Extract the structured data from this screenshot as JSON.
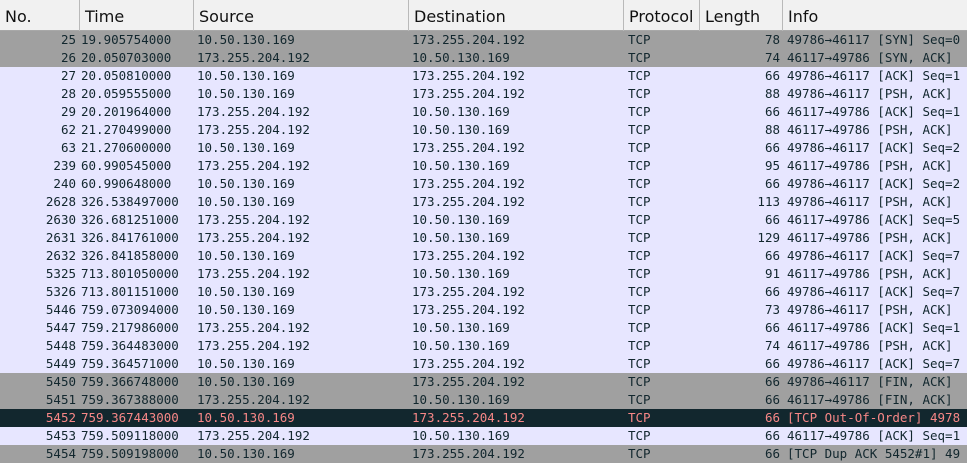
{
  "columns": [
    {
      "key": "no",
      "label": "No."
    },
    {
      "key": "time",
      "label": "Time"
    },
    {
      "key": "source",
      "label": "Source"
    },
    {
      "key": "destination",
      "label": "Destination"
    },
    {
      "key": "protocol",
      "label": "Protocol"
    },
    {
      "key": "length",
      "label": "Length"
    },
    {
      "key": "info",
      "label": "Info"
    }
  ],
  "row_styles": {
    "lavender": {
      "bg": "#e7e6ff",
      "fg": "#12272e"
    },
    "gray": {
      "bg": "#a0a0a0",
      "fg": "#12272e"
    },
    "black": {
      "bg": "#12272e",
      "fg": "#f78787"
    }
  },
  "rows": [
    {
      "no": "25",
      "time": "19.905754000",
      "source": "10.50.130.169",
      "destination": "173.255.204.192",
      "protocol": "TCP",
      "length": "78",
      "info": "49786→46117 [SYN] Seq=0",
      "style": "gray"
    },
    {
      "no": "26",
      "time": "20.050703000",
      "source": "173.255.204.192",
      "destination": "10.50.130.169",
      "protocol": "TCP",
      "length": "74",
      "info": "46117→49786 [SYN, ACK]",
      "style": "gray"
    },
    {
      "no": "27",
      "time": "20.050810000",
      "source": "10.50.130.169",
      "destination": "173.255.204.192",
      "protocol": "TCP",
      "length": "66",
      "info": "49786→46117 [ACK] Seq=1",
      "style": "lavender"
    },
    {
      "no": "28",
      "time": "20.059555000",
      "source": "10.50.130.169",
      "destination": "173.255.204.192",
      "protocol": "TCP",
      "length": "88",
      "info": "49786→46117 [PSH, ACK]",
      "style": "lavender"
    },
    {
      "no": "29",
      "time": "20.201964000",
      "source": "173.255.204.192",
      "destination": "10.50.130.169",
      "protocol": "TCP",
      "length": "66",
      "info": "46117→49786 [ACK] Seq=1",
      "style": "lavender"
    },
    {
      "no": "62",
      "time": "21.270499000",
      "source": "173.255.204.192",
      "destination": "10.50.130.169",
      "protocol": "TCP",
      "length": "88",
      "info": "46117→49786 [PSH, ACK]",
      "style": "lavender"
    },
    {
      "no": "63",
      "time": "21.270600000",
      "source": "10.50.130.169",
      "destination": "173.255.204.192",
      "protocol": "TCP",
      "length": "66",
      "info": "49786→46117 [ACK] Seq=2",
      "style": "lavender"
    },
    {
      "no": "239",
      "time": "60.990545000",
      "source": "173.255.204.192",
      "destination": "10.50.130.169",
      "protocol": "TCP",
      "length": "95",
      "info": "46117→49786 [PSH, ACK]",
      "style": "lavender"
    },
    {
      "no": "240",
      "time": "60.990648000",
      "source": "10.50.130.169",
      "destination": "173.255.204.192",
      "protocol": "TCP",
      "length": "66",
      "info": "49786→46117 [ACK] Seq=2",
      "style": "lavender"
    },
    {
      "no": "2628",
      "time": "326.538497000",
      "source": "10.50.130.169",
      "destination": "173.255.204.192",
      "protocol": "TCP",
      "length": "113",
      "info": "49786→46117 [PSH, ACK]",
      "style": "lavender"
    },
    {
      "no": "2630",
      "time": "326.681251000",
      "source": "173.255.204.192",
      "destination": "10.50.130.169",
      "protocol": "TCP",
      "length": "66",
      "info": "46117→49786 [ACK] Seq=5",
      "style": "lavender"
    },
    {
      "no": "2631",
      "time": "326.841761000",
      "source": "173.255.204.192",
      "destination": "10.50.130.169",
      "protocol": "TCP",
      "length": "129",
      "info": "46117→49786 [PSH, ACK]",
      "style": "lavender"
    },
    {
      "no": "2632",
      "time": "326.841858000",
      "source": "10.50.130.169",
      "destination": "173.255.204.192",
      "protocol": "TCP",
      "length": "66",
      "info": "49786→46117 [ACK] Seq=7",
      "style": "lavender"
    },
    {
      "no": "5325",
      "time": "713.801050000",
      "source": "173.255.204.192",
      "destination": "10.50.130.169",
      "protocol": "TCP",
      "length": "91",
      "info": "46117→49786 [PSH, ACK]",
      "style": "lavender"
    },
    {
      "no": "5326",
      "time": "713.801151000",
      "source": "10.50.130.169",
      "destination": "173.255.204.192",
      "protocol": "TCP",
      "length": "66",
      "info": "49786→46117 [ACK] Seq=7",
      "style": "lavender"
    },
    {
      "no": "5446",
      "time": "759.073094000",
      "source": "10.50.130.169",
      "destination": "173.255.204.192",
      "protocol": "TCP",
      "length": "73",
      "info": "49786→46117 [PSH, ACK]",
      "style": "lavender"
    },
    {
      "no": "5447",
      "time": "759.217986000",
      "source": "173.255.204.192",
      "destination": "10.50.130.169",
      "protocol": "TCP",
      "length": "66",
      "info": "46117→49786 [ACK] Seq=1",
      "style": "lavender"
    },
    {
      "no": "5448",
      "time": "759.364483000",
      "source": "173.255.204.192",
      "destination": "10.50.130.169",
      "protocol": "TCP",
      "length": "74",
      "info": "46117→49786 [PSH, ACK]",
      "style": "lavender"
    },
    {
      "no": "5449",
      "time": "759.364571000",
      "source": "10.50.130.169",
      "destination": "173.255.204.192",
      "protocol": "TCP",
      "length": "66",
      "info": "49786→46117 [ACK] Seq=7",
      "style": "lavender"
    },
    {
      "no": "5450",
      "time": "759.366748000",
      "source": "10.50.130.169",
      "destination": "173.255.204.192",
      "protocol": "TCP",
      "length": "66",
      "info": "49786→46117 [FIN, ACK]",
      "style": "gray"
    },
    {
      "no": "5451",
      "time": "759.367388000",
      "source": "173.255.204.192",
      "destination": "10.50.130.169",
      "protocol": "TCP",
      "length": "66",
      "info": "46117→49786 [FIN, ACK]",
      "style": "gray"
    },
    {
      "no": "5452",
      "time": "759.367443000",
      "source": "10.50.130.169",
      "destination": "173.255.204.192",
      "protocol": "TCP",
      "length": "66",
      "info": "[TCP Out-Of-Order] 4978",
      "style": "black"
    },
    {
      "no": "5453",
      "time": "759.509118000",
      "source": "173.255.204.192",
      "destination": "10.50.130.169",
      "protocol": "TCP",
      "length": "66",
      "info": "46117→49786 [ACK] Seq=1",
      "style": "lavender"
    },
    {
      "no": "5454",
      "time": "759.509198000",
      "source": "10.50.130.169",
      "destination": "173.255.204.192",
      "protocol": "TCP",
      "length": "66",
      "info": "[TCP Dup ACK 5452#1] 49",
      "style": "gray"
    }
  ]
}
